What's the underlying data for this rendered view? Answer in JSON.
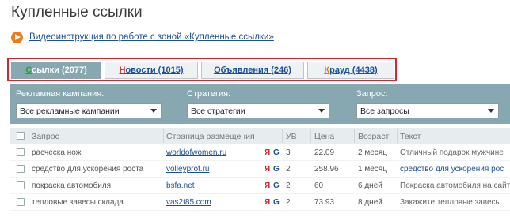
{
  "title": "Купленные ссылки",
  "video": {
    "link_text": "Видеоинструкция по работе с зоной «Купленные ссылки»"
  },
  "tabs": [
    {
      "first": "С",
      "rest": "сылки (2077)",
      "active": true,
      "first_color": "#2aa52a"
    },
    {
      "first": "Н",
      "rest": "овости (1015)",
      "active": false,
      "first_color": "#d42020"
    },
    {
      "first": "О",
      "rest": "бъявления (246)",
      "active": false,
      "first_color": "#1a4f9c"
    },
    {
      "first": "К",
      "rest": "рауд (4438)",
      "active": false,
      "first_color": "#e07a10"
    }
  ],
  "filters": {
    "campaign_label": "Рекламная кампания:",
    "campaign_value": "Все рекламные кампании",
    "strategy_label": "Стратегия:",
    "strategy_value": "Все стратегии",
    "query_label": "Запрос:",
    "query_value": "Все запросы"
  },
  "table": {
    "headers": {
      "query": "Запрос",
      "page": "Страница размещения",
      "uv": "УВ",
      "price": "Цена",
      "age": "Возраст",
      "text": "Текст"
    },
    "rows": [
      {
        "query": "расческа нож",
        "page": "worldofwomen.ru",
        "ya": "Я",
        "g": "G",
        "uv": "3",
        "price": "22.09",
        "age": "2 месяц",
        "text": "Отличный подарок мужчине",
        "text_link": false
      },
      {
        "query": "средство для ускорения роста",
        "page": "volleyprof.ru",
        "ya": "Я",
        "g": "G",
        "uv": "2",
        "price": "258.96",
        "age": "1 месяц",
        "text": "средство для ускорения рос",
        "text_link": true
      },
      {
        "query": "покраска автомобиля",
        "page": "bsfa.net",
        "ya": "Я",
        "g": "G",
        "uv": "2",
        "price": "60",
        "age": "6 дней",
        "text": "Покраска автомобиля на сайт",
        "text_link": false
      },
      {
        "query": "тепловые завесы склада",
        "page": "vas2t85.com",
        "ya": "Я",
        "g": "G",
        "uv": "2",
        "price": "73.93",
        "age": "8 дней",
        "text": "Закажите тепловые завесы",
        "text_link": false
      }
    ]
  }
}
